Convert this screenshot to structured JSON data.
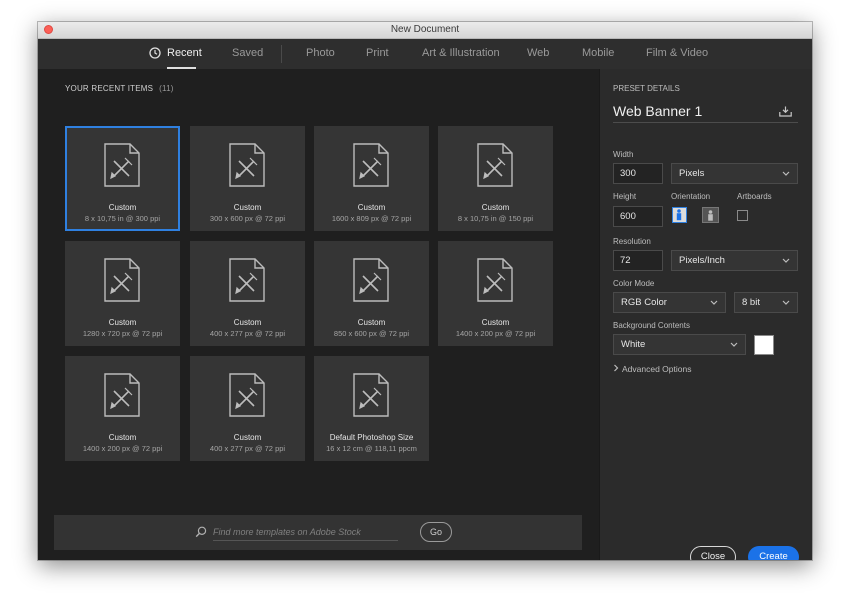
{
  "window": {
    "title": "New Document"
  },
  "tabs": [
    {
      "label": "Recent"
    },
    {
      "label": "Saved"
    },
    {
      "label": "Photo"
    },
    {
      "label": "Print"
    },
    {
      "label": "Art & Illustration"
    },
    {
      "label": "Web"
    },
    {
      "label": "Mobile"
    },
    {
      "label": "Film & Video"
    }
  ],
  "recent": {
    "header": "YOUR RECENT ITEMS",
    "count": "(11)",
    "items": [
      {
        "name": "Custom",
        "dims": "8 x 10,75 in @ 300 ppi"
      },
      {
        "name": "Custom",
        "dims": "300 x 600 px @ 72 ppi"
      },
      {
        "name": "Custom",
        "dims": "1600 x 809 px @ 72 ppi"
      },
      {
        "name": "Custom",
        "dims": "8 x 10,75 in @ 150 ppi"
      },
      {
        "name": "Custom",
        "dims": "1280 x 720 px @ 72 ppi"
      },
      {
        "name": "Custom",
        "dims": "400 x 277 px @ 72 ppi"
      },
      {
        "name": "Custom",
        "dims": "850 x 600 px @ 72 ppi"
      },
      {
        "name": "Custom",
        "dims": "1400 x 200 px @ 72 ppi"
      },
      {
        "name": "Custom",
        "dims": "1400 x 200 px @ 72 ppi"
      },
      {
        "name": "Custom",
        "dims": "400 x 277 px @ 72 ppi"
      },
      {
        "name": "Default Photoshop Size",
        "dims": "16 x 12 cm @ 118,11 ppcm"
      }
    ]
  },
  "stock": {
    "placeholder": "Find more templates on Adobe Stock",
    "go_label": "Go"
  },
  "preset": {
    "section_label": "PRESET DETAILS",
    "name": "Web Banner 1",
    "width_label": "Width",
    "width_value": "300",
    "width_unit": "Pixels",
    "height_label": "Height",
    "height_value": "600",
    "orientation_label": "Orientation",
    "artboards_label": "Artboards",
    "resolution_label": "Resolution",
    "resolution_value": "72",
    "resolution_unit": "Pixels/Inch",
    "color_mode_label": "Color Mode",
    "color_mode": "RGB Color",
    "bit_depth": "8 bit",
    "background_label": "Background Contents",
    "background_value": "White",
    "background_color": "#ffffff",
    "advanced_label": "Advanced Options"
  },
  "actions": {
    "close_label": "Close",
    "create_label": "Create"
  },
  "colors": {
    "accent": "#1b72e8",
    "selection": "#2f80e0"
  }
}
